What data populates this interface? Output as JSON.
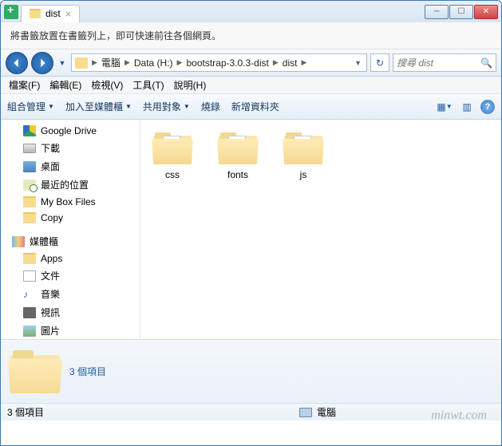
{
  "window": {
    "title": "dist"
  },
  "tip": "將書籤放置在書籤列上，即可快速前往各個網頁。",
  "breadcrumb": [
    "電腦",
    "Data (H:)",
    "bootstrap-3.0.3-dist",
    "dist"
  ],
  "search": {
    "placeholder": "搜尋 dist"
  },
  "menubar": [
    "檔案(F)",
    "編輯(E)",
    "檢視(V)",
    "工具(T)",
    "說明(H)"
  ],
  "toolbar": {
    "organize": "組合管理",
    "include": "加入至媒體櫃",
    "share": "共用對象",
    "burn": "燒錄",
    "newfolder": "新增資料夾"
  },
  "sidebar": {
    "items": [
      {
        "label": "Google Drive",
        "icon": "gdrive"
      },
      {
        "label": "下載",
        "icon": "drive"
      },
      {
        "label": "桌面",
        "icon": "desktop"
      },
      {
        "label": "最近的位置",
        "icon": "recent"
      },
      {
        "label": "My Box Files",
        "icon": "folder"
      },
      {
        "label": "Copy",
        "icon": "folder"
      }
    ],
    "library_header": "媒體櫃",
    "libraries": [
      {
        "label": "Apps",
        "icon": "folder"
      },
      {
        "label": "文件",
        "icon": "doc"
      },
      {
        "label": "音樂",
        "icon": "music"
      },
      {
        "label": "視訊",
        "icon": "video"
      },
      {
        "label": "圖片",
        "icon": "pic"
      }
    ]
  },
  "files": [
    {
      "name": "css"
    },
    {
      "name": "fonts"
    },
    {
      "name": "js"
    }
  ],
  "details": {
    "count_text": "3 個項目"
  },
  "status": {
    "count_text": "3 個項目",
    "computer": "電腦"
  },
  "watermark": "minwt.com"
}
